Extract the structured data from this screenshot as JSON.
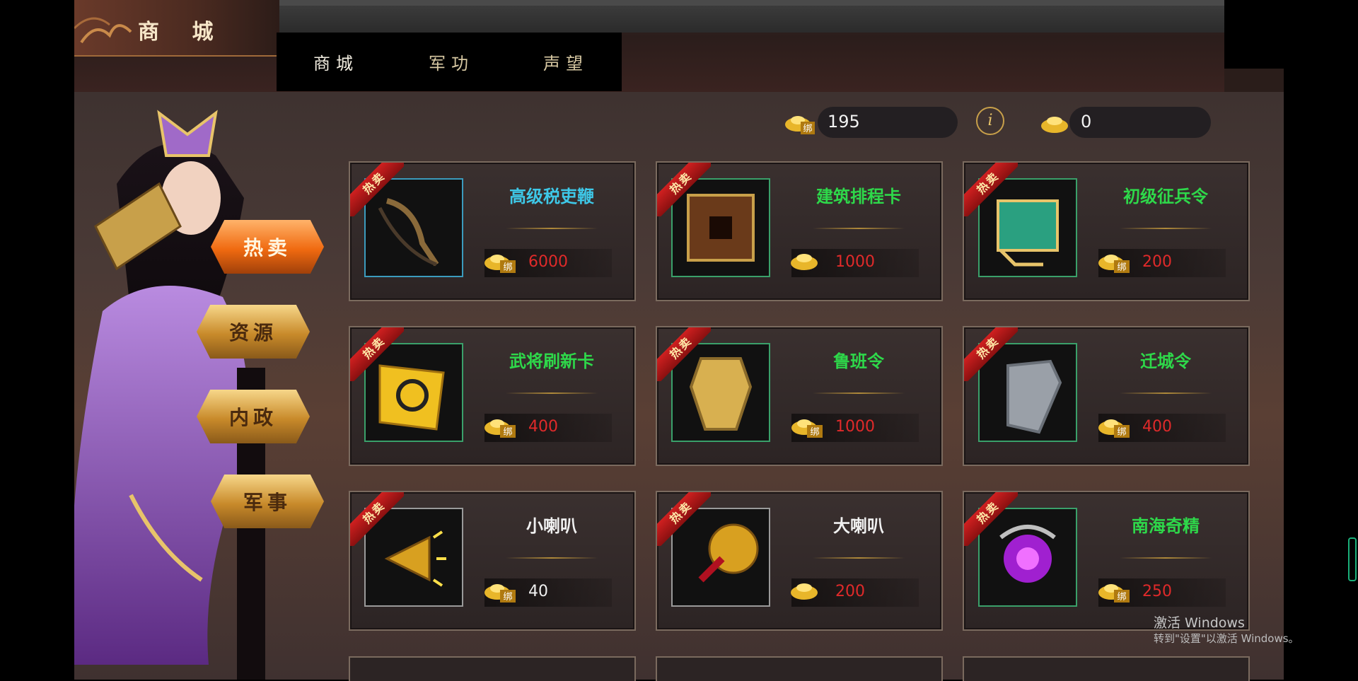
{
  "header": {
    "title": "商 城"
  },
  "tabs": [
    {
      "label": "商城",
      "active": true
    },
    {
      "label": "军功",
      "active": false
    },
    {
      "label": "声望",
      "active": false
    }
  ],
  "currency": [
    {
      "icon": "bound-gold-ingot-icon",
      "value": "195"
    },
    {
      "icon": "gold-ingot-icon",
      "value": "0"
    }
  ],
  "info_icon": "i",
  "categories": [
    {
      "label": "热卖",
      "active": true
    },
    {
      "label": "资源",
      "active": false
    },
    {
      "label": "内政",
      "active": false
    },
    {
      "label": "军事",
      "active": false
    }
  ],
  "badge": "热卖",
  "items": [
    {
      "name": "高级税吏鞭",
      "price": "6000",
      "name_color": "#3ec8e8",
      "price_color": "#e02a2a",
      "currency": "bound"
    },
    {
      "name": "建筑排程卡",
      "price": "1000",
      "name_color": "#2ed84a",
      "price_color": "#e02a2a",
      "currency": "gold"
    },
    {
      "name": "初级征兵令",
      "price": "200",
      "name_color": "#2ed84a",
      "price_color": "#e02a2a",
      "currency": "bound"
    },
    {
      "name": "武将刷新卡",
      "price": "400",
      "name_color": "#2ed84a",
      "price_color": "#e02a2a",
      "currency": "bound"
    },
    {
      "name": "鲁班令",
      "price": "1000",
      "name_color": "#2ed84a",
      "price_color": "#e02a2a",
      "currency": "bound"
    },
    {
      "name": "迁城令",
      "price": "400",
      "name_color": "#2ed84a",
      "price_color": "#e02a2a",
      "currency": "bound"
    },
    {
      "name": "小喇叭",
      "price": "40",
      "name_color": "#f0f0f0",
      "price_color": "#f0f0f0",
      "currency": "bound"
    },
    {
      "name": "大喇叭",
      "price": "200",
      "name_color": "#f0f0f0",
      "price_color": "#e02a2a",
      "currency": "gold"
    },
    {
      "name": "南海奇精",
      "price": "250",
      "name_color": "#2ed84a",
      "price_color": "#e02a2a",
      "currency": "bound"
    }
  ],
  "watermark": {
    "line1": "激活 Windows",
    "line2": "转到\"设置\"以激活 Windows。"
  }
}
